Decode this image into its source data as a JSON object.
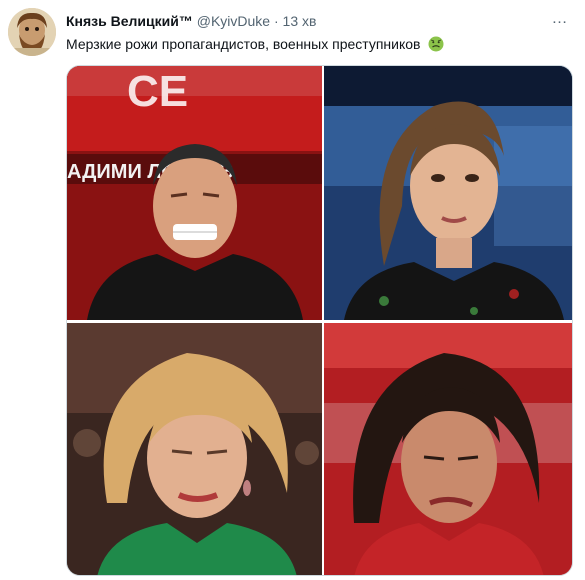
{
  "tweet": {
    "display_name": "Князь Велицкий™",
    "handle": "@KyivDuke",
    "separator": "·",
    "time": "13 хв",
    "more_icon": "…",
    "text": "Мерзкие рожи пропагандистов, военных преступников",
    "emoji": "nauseated-face"
  },
  "media": {
    "photo1_banner": "АДИМИ    ЛОВЬЕВ",
    "photo1_top": "СЕ"
  },
  "colors": {
    "handle": "#536471",
    "emoji": "#6fa84a",
    "border": "#cfd9de"
  }
}
